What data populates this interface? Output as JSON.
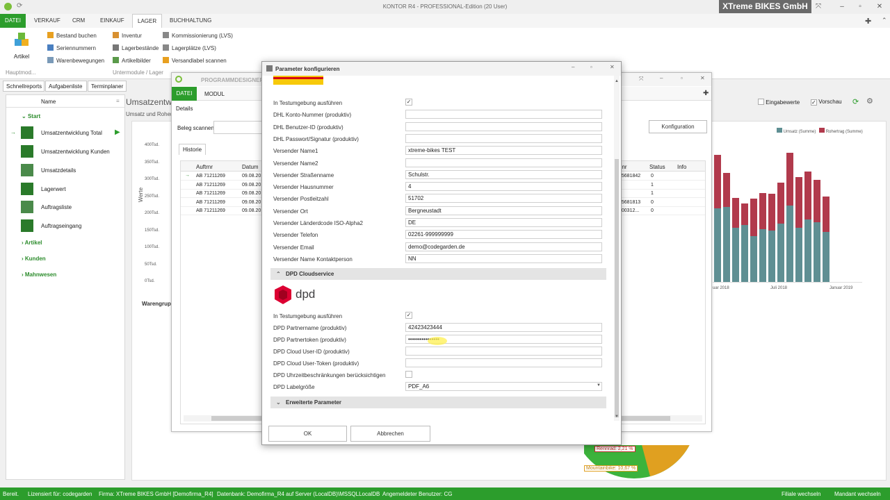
{
  "window": {
    "title": "KONTOR R4 - PROFESSIONAL-Edition (20 User)",
    "company": "XTreme BIKES GmbH"
  },
  "menu": [
    "DATEI",
    "VERKAUF",
    "CRM",
    "EINKAUF",
    "LAGER",
    "BUCHHALTUNG"
  ],
  "ribbon": {
    "big_button": "Artikel",
    "col1": [
      "Bestand buchen",
      "Seriennummern",
      "Warenbewegungen"
    ],
    "col2": [
      "Inventur",
      "Lagerbestände",
      "Artikelbilder"
    ],
    "col3": [
      "Kommissionierung (LVS)",
      "Lagerplätze (LVS)",
      "Versandlabel scannen"
    ],
    "group1": "Hauptmod...",
    "group2": "Untermodule / Lager"
  },
  "tabs": [
    "Schnellreports",
    "Aufgabenliste",
    "Terminplaner"
  ],
  "sidebar": {
    "header": "Name",
    "start": "Start",
    "items": [
      "Umsatzentwicklung Total",
      "Umsatzentwicklung Kunden",
      "Umsatzdetails",
      "Lagerwert",
      "Auftragsliste",
      "Auftragseingang"
    ],
    "groups": [
      "Artikel",
      "Kunden",
      "Mahnwesen"
    ]
  },
  "main": {
    "title": "Umsatzentw",
    "subtitle": "Umsatz und Roher",
    "yaxis": "Werte",
    "yticks": [
      "400Tsd.",
      "350Tsd.",
      "300Tsd.",
      "250Tsd.",
      "200Tsd.",
      "150Tsd.",
      "100Tsd.",
      "50Tsd.",
      "0Tsd."
    ],
    "waren": "Warengrupp",
    "checks": {
      "eingabe": "Eingabewerte",
      "vorschau": "Vorschau"
    },
    "legend": [
      "Umsatz (Summe)",
      "Rohertrag (Summe)"
    ],
    "xticks": [
      "uar 2018",
      "Juli 2018",
      "Januar 2019"
    ],
    "pie_labels": [
      "Rennrad: 2,21 %",
      "Mountainbike: 10,67 %"
    ]
  },
  "designer": {
    "title": "PROGRAMMDESIGNER",
    "tabs": [
      "DATEI",
      "MODUL"
    ],
    "details": "Details",
    "beleg": "Beleg scannen",
    "konfig": "Konfiguration",
    "historie": "Historie",
    "cols": [
      "Auftrnr",
      "Datum"
    ],
    "rows": [
      [
        "AB 71211269",
        "09.08.20"
      ],
      [
        "AB 71211269",
        "09.08.20"
      ],
      [
        "AB 71211269",
        "09.08.20"
      ],
      [
        "AB 71211269",
        "09.08.20"
      ],
      [
        "AB 71211269",
        "09.08.20"
      ]
    ],
    "rcols": [
      "gnr",
      "Status",
      "Info"
    ],
    "rrows": [
      [
        "25681842",
        "0"
      ],
      [
        "",
        "1"
      ],
      [
        "",
        "1"
      ],
      [
        "25681813",
        "0"
      ],
      [
        "100312...",
        "0"
      ]
    ]
  },
  "dialog": {
    "title": "Parameter konfigurieren",
    "dhl_rows": [
      {
        "label": "In Testumgebung ausführen",
        "type": "check",
        "value": "✓"
      },
      {
        "label": "DHL Konto-Nummer (produktiv)",
        "type": "input",
        "value": ""
      },
      {
        "label": "DHL Benutzer-ID (produktiv)",
        "type": "input",
        "value": ""
      },
      {
        "label": "DHL Passwort/Signatur (produktiv)",
        "type": "input",
        "value": ""
      },
      {
        "label": "Versender Name1",
        "type": "input",
        "value": "xtreme-bikes TEST"
      },
      {
        "label": "Versender Name2",
        "type": "input",
        "value": ""
      },
      {
        "label": "Versender Straßenname",
        "type": "input",
        "value": "Schulstr."
      },
      {
        "label": "Versender Hausnummer",
        "type": "input",
        "value": "4"
      },
      {
        "label": "Versender Postleitzahl",
        "type": "input",
        "value": "51702"
      },
      {
        "label": "Versender Ort",
        "type": "input",
        "value": "Bergneustadt"
      },
      {
        "label": "Versender Länderdcode ISO-Alpha2",
        "type": "input",
        "value": "DE"
      },
      {
        "label": "Versender Telefon",
        "type": "input",
        "value": "02261-999999999"
      },
      {
        "label": "Versender Email",
        "type": "input",
        "value": "demo@codegarden.de"
      },
      {
        "label": "Versender Name Kontaktperson",
        "type": "input",
        "value": "NN"
      }
    ],
    "dpd_section": "DPD Cloudservice",
    "dpd_logo": "dpd",
    "dpd_rows": [
      {
        "label": "In Testumgebung ausführen",
        "type": "check",
        "value": "✓"
      },
      {
        "label": "DPD Partnername (produktiv)",
        "type": "input",
        "value": "42423423444"
      },
      {
        "label": "DPD Partnertoken (produktiv)",
        "type": "input",
        "value": "••••••••••••••••"
      },
      {
        "label": "DPD Cloud User-ID (produktiv)",
        "type": "input",
        "value": ""
      },
      {
        "label": "DPD Cloud User-Token (produktiv)",
        "type": "input",
        "value": ""
      },
      {
        "label": "DPD Uhrzeitbeschränkungen berücksichtigen",
        "type": "check",
        "value": ""
      },
      {
        "label": "DPD Labelgröße",
        "type": "select",
        "value": "PDF_A6"
      }
    ],
    "erweitert": "Erweiterte Parameter",
    "ok": "OK",
    "cancel": "Abbrechen"
  },
  "status": [
    "Bereit.",
    "Lizensiert für: codegarden",
    "Firma: XTreme BIKES GmbH [Demofirma_R4]",
    "Datenbank: Demofirma_R4 auf Server (LocalDB)\\MSSQLLocalDB",
    "Angemeldeter Benutzer: CG",
    "Filiale wechseln",
    "Mandant wechseln"
  ],
  "colors": {
    "green": "#2c9d2c",
    "umsatz": "#5f8f93",
    "rohertrag": "#b13a4c"
  }
}
